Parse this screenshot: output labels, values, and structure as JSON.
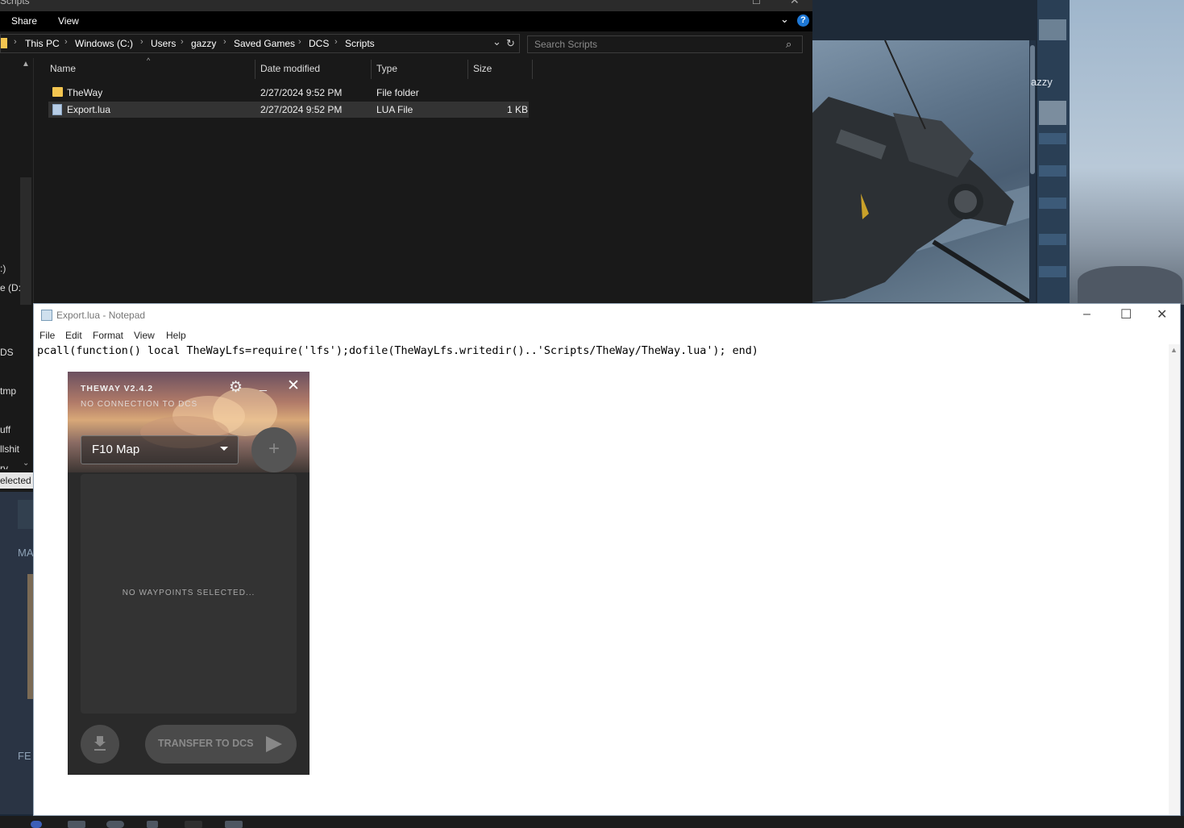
{
  "explorer": {
    "window_title": "Scripts",
    "ribbon_tabs": [
      "Share",
      "View"
    ],
    "breadcrumbs": [
      "This PC",
      "Windows (C:)",
      "Users",
      "gazzy",
      "Saved Games",
      "DCS",
      "Scripts"
    ],
    "search_placeholder": "Search Scripts",
    "columns": [
      "Name",
      "Date modified",
      "Type",
      "Size"
    ],
    "files": [
      {
        "name": "TheWay",
        "date": "2/27/2024 9:52 PM",
        "type": "File folder",
        "size": ""
      },
      {
        "name": "Export.lua",
        "date": "2/27/2024 9:52 PM",
        "type": "LUA File",
        "size": "1 KB"
      }
    ],
    "nav_items": [
      ":)",
      "e (D:",
      "DS",
      "tmp",
      "uff",
      "llshit",
      "ry"
    ],
    "status_text": "elected"
  },
  "steam": {
    "user_partial": "azzy",
    "left_labels": [
      "MA",
      "FE"
    ]
  },
  "notepad": {
    "title": "Export.lua - Notepad",
    "menu": [
      "File",
      "Edit",
      "Format",
      "View",
      "Help"
    ],
    "content": "pcall(function() local TheWayLfs=require('lfs');dofile(TheWayLfs.writedir()..'Scripts/TheWay/TheWay.lua'); end)"
  },
  "theway": {
    "title": "THEWAY V2.4.2",
    "status": "NO CONNECTION TO DCS",
    "source_selected": "F10 Map",
    "empty_message": "NO WAYPOINTS SELECTED...",
    "transfer_label": "TRANSFER TO DCS"
  }
}
